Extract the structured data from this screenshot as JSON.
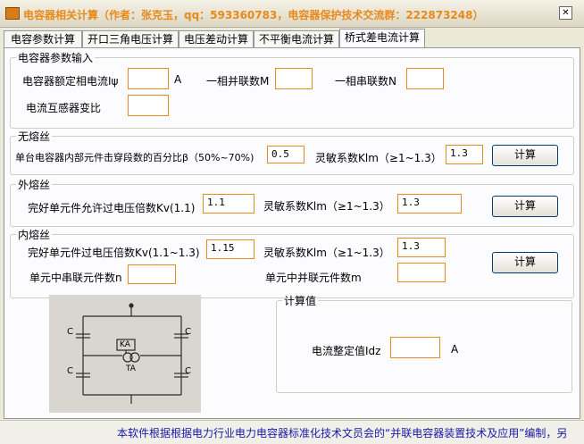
{
  "window": {
    "title": "电容器相关计算（作者：张克玉，qq：593360783，电容器保护技术交流群：222873248）",
    "close": "✕"
  },
  "tabs": [
    "电容参数计算",
    "开口三角电压计算",
    "电压差动计算",
    "不平衡电流计算",
    "桥式差电流计算"
  ],
  "active_tab": 4,
  "capacitor_params": {
    "legend": "电容器参数输入",
    "rated_current_label": "电容器额定相电流Iψ",
    "rated_current_unit": "A",
    "rated_current_value": "",
    "parallel_count_label": "一相并联数M",
    "parallel_count_value": "",
    "series_count_label": "一相串联数N",
    "series_count_value": "",
    "ct_ratio_label": "电流互感器变比",
    "ct_ratio_value": ""
  },
  "no_fuse": {
    "legend": "无熔丝",
    "beta_label": "单台电容器内部元件击穿段数的百分比β（50%~70%)",
    "beta_value": "0.5",
    "sensitivity_label": "灵敏系数Klm（≥1~1.3）",
    "sensitivity_value": "1.3",
    "calc_button": "计算"
  },
  "external_fuse": {
    "legend": "外熔丝",
    "kv_label": "完好单元件允许过电压倍数Kv(1.1)",
    "kv_value": "1.1",
    "sensitivity_label": "灵敏系数Klm（≥1~1.3）",
    "sensitivity_value": "1.3",
    "calc_button": "计算"
  },
  "internal_fuse": {
    "legend": "内熔丝",
    "kv_label": "完好单元件过电压倍数Kv(1.1~1.3)",
    "kv_value": "1.15",
    "sensitivity_label": "灵敏系数Klm（≥1~1.3）",
    "sensitivity_value": "1.3",
    "series_label": "单元中串联元件数n",
    "series_value": "",
    "parallel_label": "单元中并联元件数m",
    "parallel_value": "",
    "calc_button": "计算"
  },
  "diagram": {
    "c_label": "C",
    "ka_label": "KA",
    "ta_label": "TA"
  },
  "result": {
    "legend": "计算值",
    "setting_label": "电流整定值Idz",
    "setting_value": "",
    "unit": "A"
  },
  "status": {
    "text": "本软件根据根据电力行业电力电容器标准化技术文员会的“并联电容器装置技术及应用”编制，另"
  },
  "colors": {
    "title_orange": "#e8891a",
    "input_border": "#e38b1e",
    "status_blue": "#1a1aa8"
  }
}
